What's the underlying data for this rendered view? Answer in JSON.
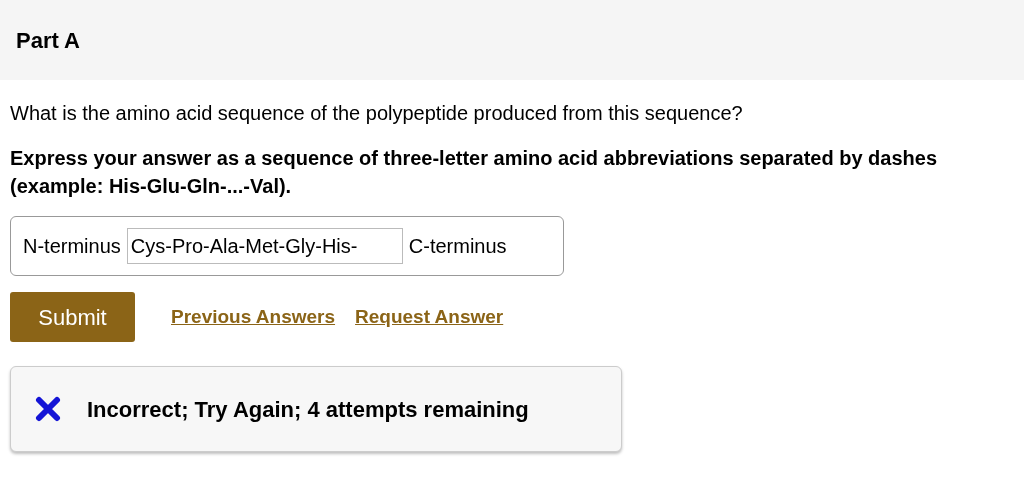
{
  "part": {
    "title": "Part A"
  },
  "question": "What is the amino acid sequence of the polypeptide produced from this sequence?",
  "instructions": "Express your answer as a sequence of three-letter amino acid abbreviations separated by dashes (example: His-Glu-Gln-...-Val).",
  "answer": {
    "prefix": "N-terminus",
    "value": "Cys-Pro-Ala-Met-Gly-His-",
    "suffix": "C-terminus"
  },
  "actions": {
    "submit": "Submit",
    "links": [
      "Previous Answers",
      "Request Answer"
    ]
  },
  "feedback": {
    "kind": "incorrect",
    "text": "Incorrect; Try Again; 4 attempts remaining"
  }
}
